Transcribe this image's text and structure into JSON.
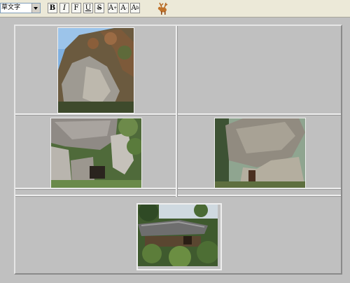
{
  "toolbar": {
    "font_value": "草文字",
    "buttons": [
      {
        "label": "B"
      },
      {
        "label": "I"
      },
      {
        "label": "F"
      },
      {
        "label": "U"
      },
      {
        "label": "S"
      },
      {
        "label": "A",
        "sup": "+"
      },
      {
        "label": "A",
        "sup": "-"
      },
      {
        "label": "A",
        "sup": "b"
      }
    ],
    "mascot_icon": "reindeer-icon"
  },
  "images": [
    {
      "name": "cliff-rock-photo",
      "icon": "photo"
    },
    {
      "name": "cave-rock-photo",
      "icon": "photo"
    },
    {
      "name": "overhang-rock-photo",
      "icon": "photo"
    },
    {
      "name": "shrine-house-photo",
      "icon": "photo"
    }
  ],
  "colors": {
    "toolbar_bg": "#ece9d8",
    "editor_bg": "#c0c0c0",
    "grid_line": "#e4e4e4"
  }
}
